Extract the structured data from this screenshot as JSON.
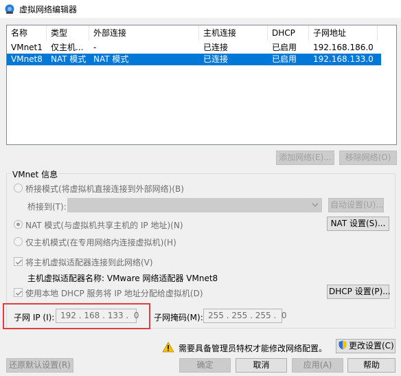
{
  "window": {
    "title": "虚拟网络编辑器"
  },
  "network_list": {
    "columns": [
      "名称",
      "类型",
      "外部连接",
      "主机连接",
      "DHCP",
      "子网地址"
    ],
    "rows": [
      {
        "name": "VMnet1",
        "type": "仅主机...",
        "external": "-",
        "host": "已连接",
        "dhcp": "已启用",
        "subnet": "192.168.186.0",
        "selected": false
      },
      {
        "name": "VMnet8",
        "type": "NAT 模式",
        "external": "NAT 模式",
        "host": "已连接",
        "dhcp": "已启用",
        "subnet": "192.168.133.0",
        "selected": true
      }
    ]
  },
  "list_buttons": {
    "add": "添加网络(E)...",
    "remove": "移除网络(O)"
  },
  "vmnet_info": {
    "title": "VMnet 信息",
    "bridged_label": "桥接模式(将虚拟机直接连接到外部网络)(B)",
    "bridged_to_label": "桥接到(T):",
    "bridged_to_value": "",
    "auto_settings": "自动设置(U)...",
    "nat_label": "NAT 模式(与虚拟机共享主机的 IP 地址)(N)",
    "nat_settings": "NAT 设置(S)...",
    "hostonly_label": "仅主机模式(在专用网络内连接虚拟机)(H)",
    "connect_adapter_label": "将主机虚拟适配器连接到此网络(V)",
    "adapter_name_label": "主机虚拟适配器名称: VMware 网络适配器 VMnet8",
    "use_dhcp_label": "使用本地 DHCP 服务将 IP 地址分配给虚拟机(D)",
    "dhcp_settings": "DHCP 设置(P)...",
    "subnet_ip_label": "子网 IP (I):",
    "subnet_ip_value": "192 . 168 . 133 .  0",
    "subnet_mask_label": "子网掩码(M):",
    "subnet_mask_value": "255 . 255 . 255 .  0"
  },
  "admin_notice": {
    "text": "需要具备管理员特权才能修改网络配置。",
    "change_settings": "更改设置(C)"
  },
  "footer": {
    "restore_defaults": "还原默认设置(R)",
    "ok": "确定",
    "cancel": "取消",
    "apply": "应用(A)",
    "help": "帮助"
  },
  "colors": {
    "selection": "#0078d7",
    "highlight_box": "#e33c3c"
  }
}
